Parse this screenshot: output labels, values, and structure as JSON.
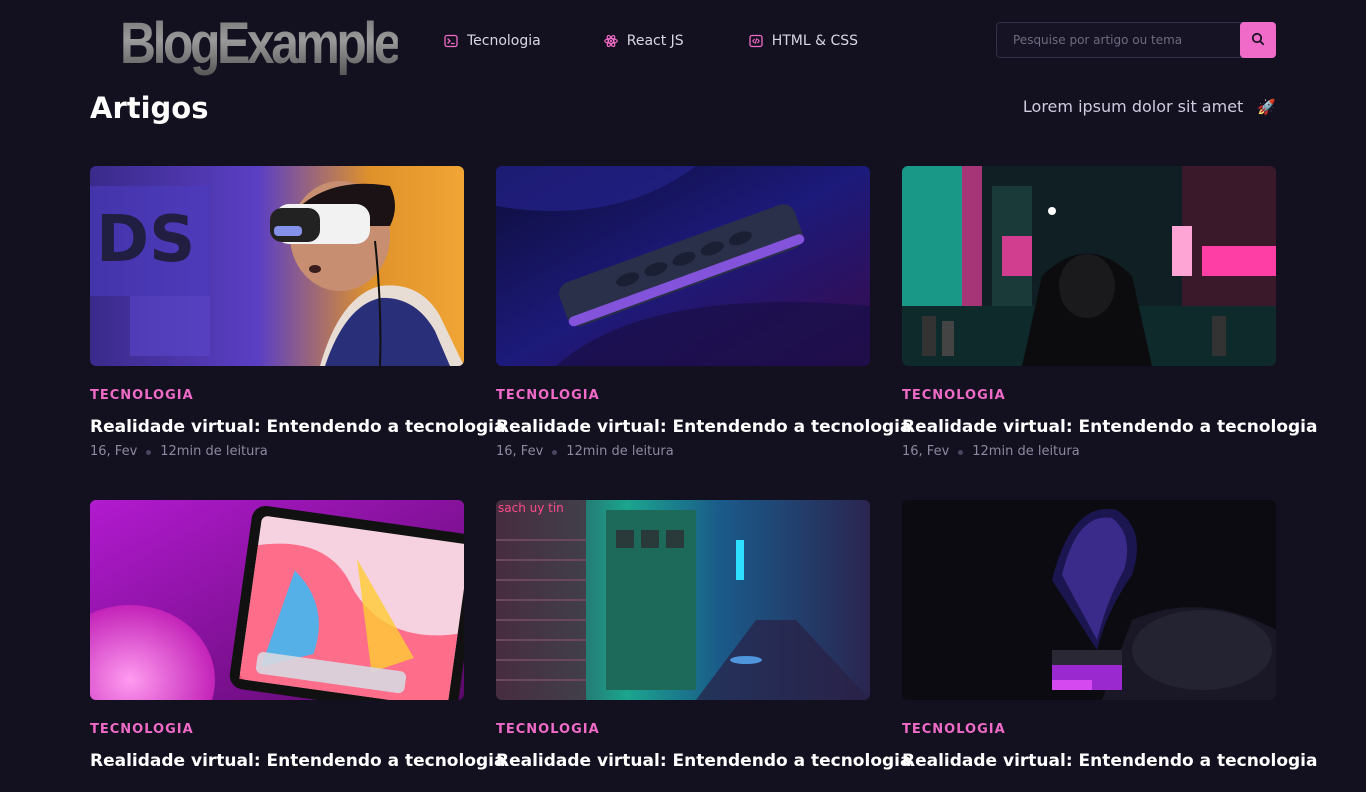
{
  "header": {
    "logo": "BlogExample",
    "nav": [
      {
        "label": "Tecnologia",
        "icon": "terminal-icon"
      },
      {
        "label": "React JS",
        "icon": "atom-icon"
      },
      {
        "label": "HTML & CSS",
        "icon": "code-icon"
      }
    ],
    "search": {
      "placeholder": "Pesquise por artigo ou tema",
      "icon": "search-icon"
    }
  },
  "main": {
    "title": "Artigos",
    "tagline": "Lorem ipsum dolor sit amet",
    "tagline_icon": "🚀"
  },
  "posts": [
    {
      "category": "TECNOLOGIA",
      "title": "Realidade virtual: Entendendo a tecnologia",
      "date": "16, Fev",
      "read_time": "12min de leitura",
      "image": "vr-headset-image"
    },
    {
      "category": "TECNOLOGIA",
      "title": "Realidade virtual: Entendendo a tecnologia",
      "date": "16, Fev",
      "read_time": "12min de leitura",
      "image": "remote-control-image"
    },
    {
      "category": "TECNOLOGIA",
      "title": "Realidade virtual: Entendendo a tecnologia",
      "date": "16, Fev",
      "read_time": "12min de leitura",
      "image": "neon-street-hood-image"
    },
    {
      "category": "TECNOLOGIA",
      "title": "Realidade virtual: Entendendo a tecnologia",
      "image": "tablet-image"
    },
    {
      "category": "TECNOLOGIA",
      "title": "Realidade virtual: Entendendo a tecnologia",
      "image": "neon-alley-image"
    },
    {
      "category": "TECNOLOGIA",
      "title": "Realidade virtual: Entendendo a tecnologia",
      "image": "gramophone-image"
    }
  ],
  "colors": {
    "background": "#13101f",
    "accent": "#f06bc7",
    "text": "#ffffff",
    "muted": "#8d89a0"
  }
}
